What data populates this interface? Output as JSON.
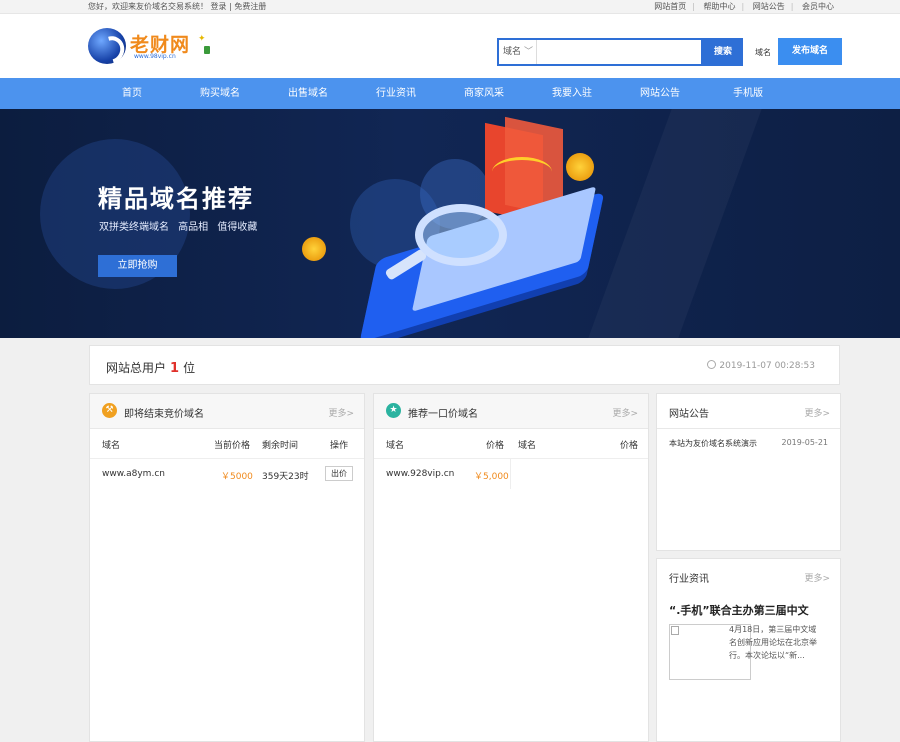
{
  "topbar": {
    "welcome": "您好，欢迎来友价域名交易系统！",
    "login": "登录",
    "register": "免费注册",
    "links": [
      "网站首页",
      "帮助中心",
      "网站公告",
      "会员中心"
    ]
  },
  "header": {
    "logo_name": "老财网",
    "logo_domain": "www.98vip.cn",
    "search_type": "域名",
    "search_placeholder": "",
    "search_button": "搜索",
    "mini_label": "域名",
    "publish_button": "发布域名"
  },
  "nav": [
    "首页",
    "购买域名",
    "出售域名",
    "行业资讯",
    "商家风采",
    "我要入驻",
    "网站公告",
    "手机版"
  ],
  "banner": {
    "title": "精品域名推荐",
    "subtitle": "双拼类终端域名  高品相  值得收藏",
    "cta": "立即抢购"
  },
  "stats": {
    "label_prefix": "网站总用户",
    "count": "1",
    "label_suffix": "位",
    "time": "2019-11-07 00:28:53"
  },
  "auction": {
    "title": "即将结束竞价域名",
    "more": "更多>",
    "headers": [
      "域名",
      "当前价格",
      "剩余时间",
      "操作"
    ],
    "rows": [
      {
        "domain": "www.a8ym.cn",
        "price": "￥5000",
        "remaining": "359天23时",
        "action": "出价"
      }
    ]
  },
  "fixed": {
    "title": "推荐一口价域名",
    "more": "更多>",
    "headers": [
      "域名",
      "价格",
      "域名",
      "价格"
    ],
    "rows": [
      {
        "domain": "www.928vip.cn",
        "price": "￥5,000"
      }
    ]
  },
  "notice": {
    "title": "网站公告",
    "more": "更多>",
    "items": [
      {
        "text": "本站为友价域名系统演示",
        "date": "2019-05-21"
      }
    ]
  },
  "news": {
    "title": "行业资讯",
    "more": "更多>",
    "headline": "“.手机”联合主办第三届中文",
    "excerpt": "4月18日，第三届中文域名创新应用论坛在北京举行。本次论坛以“新..."
  },
  "colors": {
    "nav": "#4c93ee",
    "primary": "#2e6fd6",
    "price": "#f08a1c",
    "count": "#e0302a"
  }
}
